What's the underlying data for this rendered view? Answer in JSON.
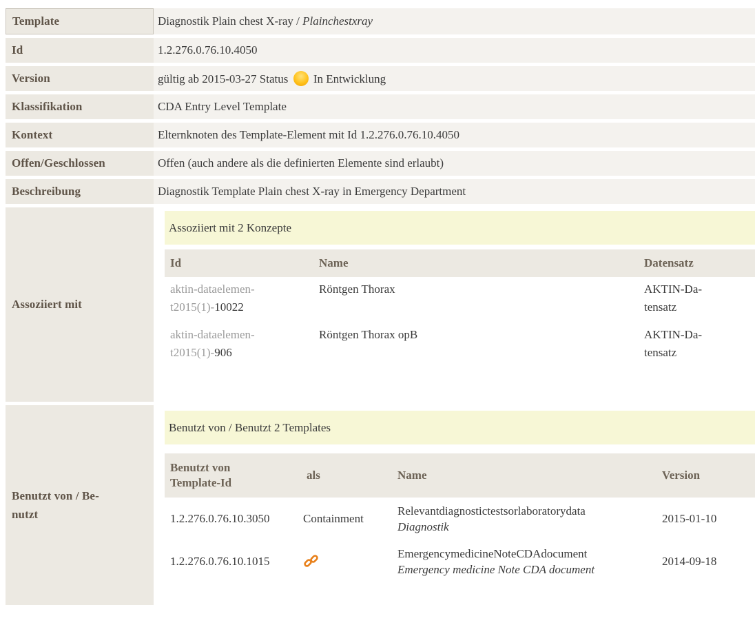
{
  "rows": {
    "template": {
      "label": "Template",
      "value": "Diagnostik Plain chest X-ray / ",
      "value_italic": "Plainchestxray"
    },
    "id": {
      "label": "Id",
      "value": "1.2.276.0.76.10.4050"
    },
    "version": {
      "label": "Version",
      "prefix": "gültig ab 2015-03-27 Status",
      "status": "In Entwicklung",
      "status_icon": "status-yellow-dot-icon"
    },
    "klassifikation": {
      "label": "Klassifikation",
      "value": "CDA Entry Level Template"
    },
    "kontext": {
      "label": "Kontext",
      "value": "Elternknoten des Template-Element mit Id 1.2.276.0.76.10.4050"
    },
    "offen": {
      "label": "Offen/Geschlossen",
      "value": "Offen (auch andere als die definierten Elemente sind erlaubt)"
    },
    "beschreibung": {
      "label": "Beschreibung",
      "value": "Diagnostik Template Plain chest X-ray in Emergency Department"
    }
  },
  "assoziiert": {
    "label": "Assoziiert mit",
    "title": "Assoziiert mit 2 Konzepte",
    "headers": [
      "Id",
      "Name",
      "Datensatz"
    ],
    "items": [
      {
        "id_line1": "aktin-dataelemen-",
        "id_line2_grey": "t2015(1)-",
        "id_line2_dark": "10022",
        "name": "Röntgen Thorax",
        "ds_line1": "AKTIN-Da-",
        "ds_line2": "tensatz"
      },
      {
        "id_line1": "aktin-dataelemen-",
        "id_line2_grey": "t2015(1)-",
        "id_line2_dark": "906",
        "name": "Röntgen Thorax opB",
        "ds_line1": "AKTIN-Da-",
        "ds_line2": "tensatz"
      }
    ]
  },
  "benutzt": {
    "label_line1": "Benutzt von / Be-",
    "label_line2": "nutzt",
    "title": "Benutzt von / Benutzt 2 Templates",
    "headers": {
      "h1_line1": "Benutzt von",
      "h1_line2": "Template-Id",
      "h2": "als",
      "h3": "Name",
      "h4": "Version"
    },
    "items": [
      {
        "tid": "1.2.276.0.76.10.3050",
        "als": "Containment",
        "name": "Relevantdiagnostictestsorlaboratorydata",
        "name_italic": "Diagnostik",
        "version": "2015-01-10"
      },
      {
        "tid": "1.2.276.0.76.10.1015",
        "als_icon": "chain-link-icon",
        "name": "EmergencymedicineNoteCDAdocument",
        "name_italic": "Emergency medicine Note CDA document",
        "version": "2014-09-18"
      }
    ]
  },
  "colors": {
    "label_bg": "#ece9e2",
    "value_bg": "#f4f2ee",
    "sub_header_bg": "#f7f7d6",
    "link_icon": "#e8801a",
    "status_dot": "#ffc21c"
  }
}
